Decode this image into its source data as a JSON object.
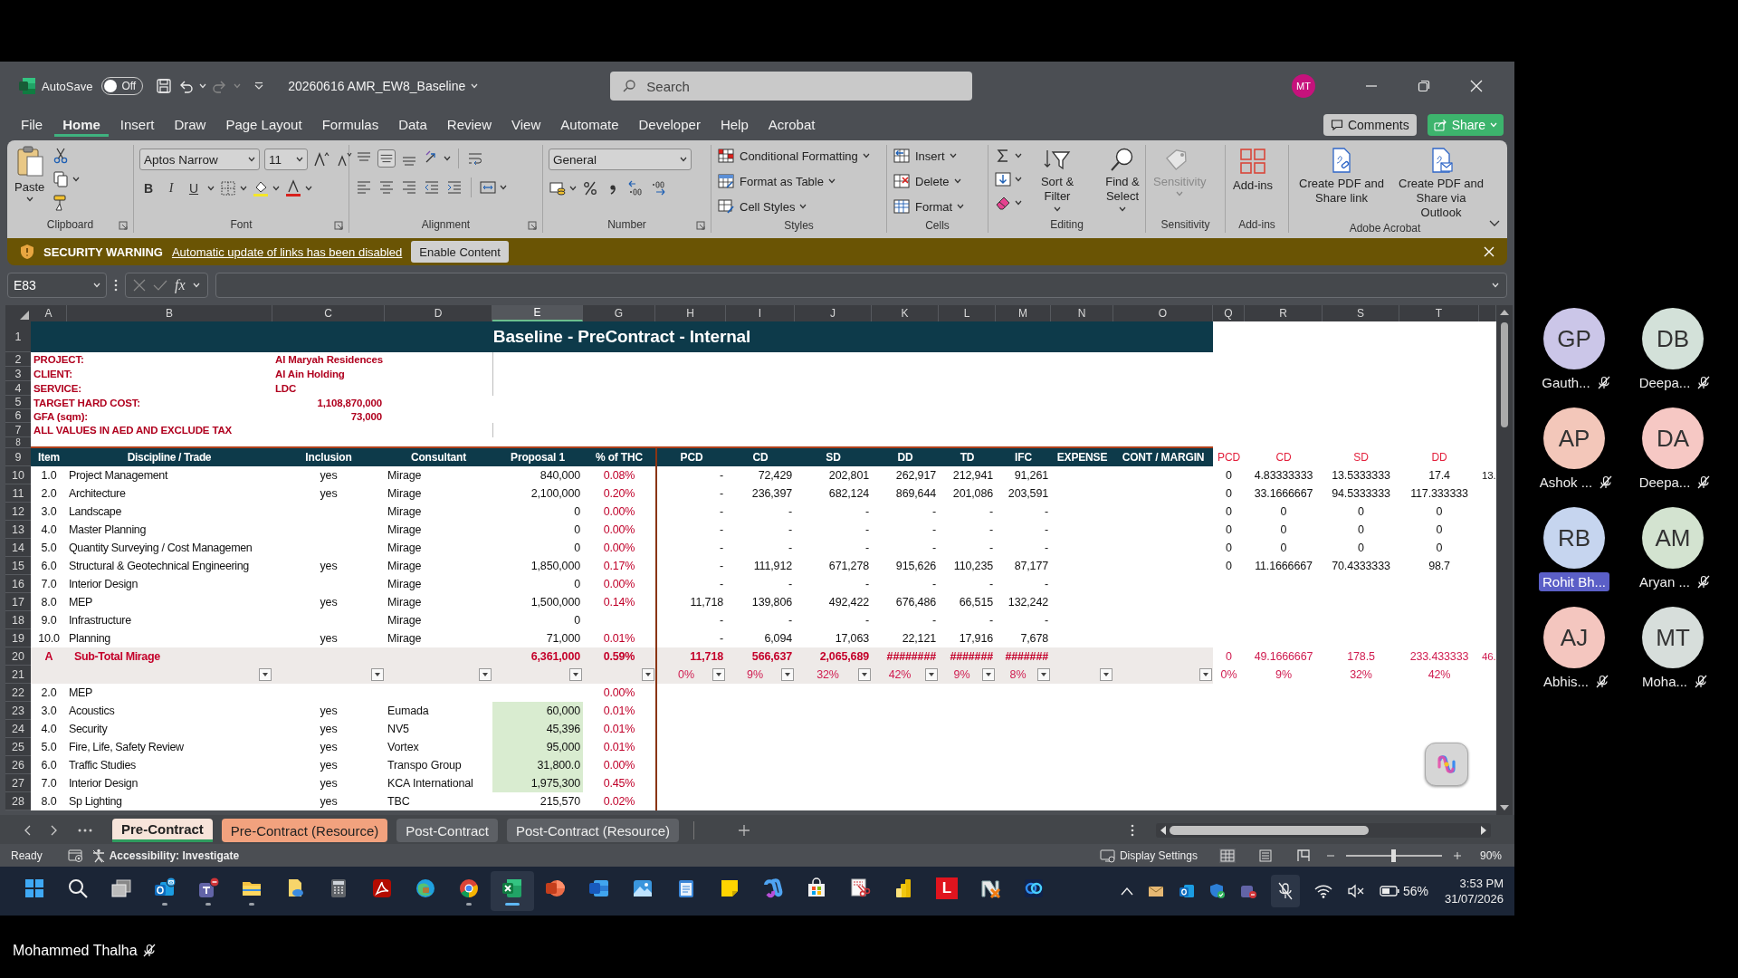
{
  "title_bar": {
    "autosave_label": "AutoSave",
    "autosave": {
      "label": "Off",
      "on": false
    },
    "file_name": "20260616 AMR_EW8_Baseline",
    "search": {
      "placeholder": "Search"
    },
    "avatar": "MT"
  },
  "menu": {
    "tabs": [
      {
        "label": "File",
        "selected": false
      },
      {
        "label": "Home",
        "selected": true
      },
      {
        "label": "Insert",
        "selected": false
      },
      {
        "label": "Draw",
        "selected": false
      },
      {
        "label": "Page Layout",
        "selected": false
      },
      {
        "label": "Formulas",
        "selected": false
      },
      {
        "label": "Data",
        "selected": false
      },
      {
        "label": "Review",
        "selected": false
      },
      {
        "label": "View",
        "selected": false
      },
      {
        "label": "Automate",
        "selected": false
      },
      {
        "label": "Developer",
        "selected": false
      },
      {
        "label": "Help",
        "selected": false
      },
      {
        "label": "Acrobat",
        "selected": false
      }
    ],
    "comments": "Comments",
    "share": "Share"
  },
  "ribbon": {
    "groups": [
      {
        "kind": "clipboard",
        "label": "Clipboard",
        "launcher": true,
        "buttons": [
          "Paste"
        ]
      },
      {
        "kind": "font",
        "label": "Font",
        "launcher": true,
        "font_name": "Aptos Narrow",
        "font_size": "11",
        "buttons": [
          "B",
          "I",
          "U"
        ]
      },
      {
        "kind": "alignment",
        "label": "Alignment",
        "launcher": true
      },
      {
        "kind": "number",
        "label": "Number",
        "launcher": true,
        "format": "General"
      },
      {
        "kind": "styles",
        "label": "Styles",
        "launcher": false,
        "buttons": [
          "Conditional Formatting",
          "Format as Table",
          "Cell Styles"
        ]
      },
      {
        "kind": "cells",
        "label": "Cells",
        "launcher": false,
        "buttons": [
          "Insert",
          "Delete",
          "Format"
        ]
      },
      {
        "kind": "editing",
        "label": "Editing",
        "launcher": false,
        "buttons": [
          "Sort & Filter",
          "Find & Select"
        ]
      },
      {
        "kind": "sensitivity",
        "label": "Sensitivity",
        "launcher": false,
        "disabled": true,
        "buttons": [
          "Sensitivity"
        ]
      },
      {
        "kind": "addins",
        "label": "Add-ins",
        "launcher": false,
        "buttons": [
          "Add-ins"
        ]
      },
      {
        "kind": "acrobat",
        "label": "Adobe Acrobat",
        "launcher": false,
        "buttons": [
          "Create PDF and Share link",
          "Create PDF and Share via Outlook"
        ]
      }
    ]
  },
  "security_bar": {
    "title": "SECURITY WARNING",
    "message": "Automatic update of links has been disabled",
    "button": "Enable Content"
  },
  "formula_bar": {
    "name_box": "E83",
    "function_label": "fx"
  },
  "sheet": {
    "columns": [
      {
        "letter": "A",
        "selected": false
      },
      {
        "letter": "B",
        "selected": false
      },
      {
        "letter": "C",
        "selected": false
      },
      {
        "letter": "D",
        "selected": false
      },
      {
        "letter": "E",
        "selected": true
      },
      {
        "letter": "G",
        "selected": false
      },
      {
        "letter": "H",
        "selected": false
      },
      {
        "letter": "I",
        "selected": false
      },
      {
        "letter": "J",
        "selected": false
      },
      {
        "letter": "K",
        "selected": false
      },
      {
        "letter": "L",
        "selected": false
      },
      {
        "letter": "M",
        "selected": false
      },
      {
        "letter": "N",
        "selected": false
      },
      {
        "letter": "O",
        "selected": false
      },
      {
        "letter": "Q",
        "selected": false
      },
      {
        "letter": "R",
        "selected": false
      },
      {
        "letter": "S",
        "selected": false
      },
      {
        "letter": "T",
        "selected": false
      },
      {
        "selected": false
      }
    ],
    "rows": [
      {
        "number": "1",
        "kind": "title",
        "title": "Baseline - PreContract - Internal"
      },
      {
        "number": "2",
        "kind": "info",
        "label": "PROJECT:",
        "value": "Al Maryah Residences"
      },
      {
        "number": "3",
        "kind": "info",
        "label": "CLIENT:",
        "value": "Al Ain Holding"
      },
      {
        "number": "4",
        "kind": "info",
        "label": "SERVICE:",
        "value": "LDC"
      },
      {
        "number": "5",
        "kind": "info_number",
        "label": "TARGET HARD COST:",
        "value": "1,108,870,000"
      },
      {
        "number": "6",
        "kind": "info_number",
        "label": "GFA (sqm):",
        "value": "73,000"
      },
      {
        "number": "7",
        "kind": "info",
        "label": "ALL VALUES IN AED AND EXCLUDE TAX"
      },
      {
        "number": "8",
        "kind": "spacer"
      },
      {
        "number": "9",
        "kind": "header",
        "cells": {
          "A": "Item",
          "B": "Discipline / Trade",
          "C": "Inclusion",
          "D": "Consultant",
          "E": "Proposal 1",
          "G": "% of THC",
          "H": "PCD",
          "I": "CD",
          "J": "SD",
          "K": "DD",
          "L": "TD",
          "M": "IFC",
          "N": "EXPENSE",
          "O": "CONT / MARGIN",
          "Q": "PCD",
          "R": "CD",
          "S": "SD",
          "T": "DD"
        }
      },
      {
        "number": "10",
        "kind": "item",
        "highlighted": false,
        "cells": {
          "A": "1.0",
          "B": "Project Management",
          "C": "yes",
          "D": "Mirage",
          "E": "840,000",
          "G": "0.08%",
          "H": "-",
          "I": "72,429",
          "J": "202,801",
          "K": "262,917",
          "L": "212,941",
          "M": "91,261",
          "Q": "0",
          "R": "4.83333333",
          "S": "13.5333333",
          "T": "17.4",
          "column_19": "13."
        }
      },
      {
        "number": "11",
        "kind": "item",
        "highlighted": false,
        "cells": {
          "A": "2.0",
          "B": "Architecture",
          "C": "yes",
          "D": "Mirage",
          "E": "2,100,000",
          "G": "0.20%",
          "H": "-",
          "I": "236,397",
          "J": "682,124",
          "K": "869,644",
          "L": "201,086",
          "M": "203,591",
          "Q": "0",
          "R": "33.1666667",
          "S": "94.5333333",
          "T": "117.333333"
        }
      },
      {
        "number": "12",
        "kind": "item",
        "highlighted": false,
        "cells": {
          "A": "3.0",
          "B": "Landscape",
          "D": "Mirage",
          "E": "0",
          "G": "0.00%",
          "H": "-",
          "I": "-",
          "J": "-",
          "K": "-",
          "L": "-",
          "M": "-",
          "Q": "0",
          "R": "0",
          "S": "0",
          "T": "0"
        }
      },
      {
        "number": "13",
        "kind": "item",
        "highlighted": false,
        "cells": {
          "A": "4.0",
          "B": "Master Planning",
          "D": "Mirage",
          "E": "0",
          "G": "0.00%",
          "H": "-",
          "I": "-",
          "J": "-",
          "K": "-",
          "L": "-",
          "M": "-",
          "Q": "0",
          "R": "0",
          "S": "0",
          "T": "0"
        }
      },
      {
        "number": "14",
        "kind": "item",
        "highlighted": false,
        "cells": {
          "A": "5.0",
          "B": "Quantity Surveying / Cost Managemen",
          "D": "Mirage",
          "E": "0",
          "G": "0.00%",
          "H": "-",
          "I": "-",
          "J": "-",
          "K": "-",
          "L": "-",
          "M": "-",
          "Q": "0",
          "R": "0",
          "S": "0",
          "T": "0"
        }
      },
      {
        "number": "15",
        "kind": "item",
        "highlighted": false,
        "cells": {
          "A": "6.0",
          "B": "Structural & Geotechnical Engineering",
          "C": "yes",
          "D": "Mirage",
          "E": "1,850,000",
          "G": "0.17%",
          "H": "-",
          "I": "111,912",
          "J": "671,278",
          "K": "915,626",
          "L": "110,235",
          "M": "87,177",
          "Q": "0",
          "R": "11.1666667",
          "S": "70.4333333",
          "T": "98.7"
        }
      },
      {
        "number": "16",
        "kind": "item",
        "highlighted": false,
        "cells": {
          "A": "7.0",
          "B": "Interior Design",
          "D": "Mirage",
          "E": "0",
          "G": "0.00%",
          "H": "-",
          "I": "-",
          "J": "-",
          "K": "-",
          "L": "-",
          "M": "-"
        }
      },
      {
        "number": "17",
        "kind": "item",
        "highlighted": false,
        "cells": {
          "A": "8.0",
          "B": "MEP",
          "C": "yes",
          "D": "Mirage",
          "E": "1,500,000",
          "G": "0.14%",
          "H": "11,718",
          "I": "139,806",
          "J": "492,422",
          "K": "676,486",
          "L": "66,515",
          "M": "132,242"
        }
      },
      {
        "number": "18",
        "kind": "item",
        "highlighted": false,
        "cells": {
          "A": "9.0",
          "B": "Infrastructure",
          "D": "Mirage",
          "E": "0",
          "H": "-",
          "I": "-",
          "J": "-",
          "K": "-",
          "L": "-",
          "M": "-"
        }
      },
      {
        "number": "19",
        "kind": "item",
        "highlighted": false,
        "cells": {
          "A": "10.0",
          "B": "Planning",
          "C": "yes",
          "D": "Mirage",
          "E": "71,000",
          "G": "0.01%",
          "H": "-",
          "I": "6,094",
          "J": "17,063",
          "K": "22,121",
          "L": "17,916",
          "M": "7,678"
        }
      },
      {
        "number": "20",
        "kind": "subtotal",
        "cells": {
          "A": "A",
          "B": "Sub-Total Mirage",
          "E": "6,361,000",
          "G": "0.59%",
          "H": "11,718",
          "I": "566,637",
          "J": "2,065,689",
          "K": "########",
          "L": "#######",
          "M": "#######",
          "Q": "0",
          "R": "49.1666667",
          "S": "178.5",
          "T": "233.433333",
          "column_19": "46."
        }
      },
      {
        "number": "21",
        "kind": "filter",
        "cells": {
          "B": {
            "filter": true
          },
          "C": {
            "filter": true
          },
          "D": {
            "filter": true
          },
          "E": {
            "filter": true
          },
          "G": {
            "filter": true
          },
          "H": {
            "value": "0%",
            "filter": true
          },
          "I": {
            "value": "9%",
            "filter": true
          },
          "J": {
            "value": "32%",
            "filter": true
          },
          "K": {
            "value": "42%",
            "filter": true
          },
          "L": {
            "value": "9%",
            "filter": true
          },
          "M": {
            "value": "8%",
            "filter": true
          },
          "N": {
            "filter": true
          },
          "O": {
            "filter": true
          },
          "Q": {
            "value": "0%",
            "filter": false
          },
          "R": {
            "value": "9%",
            "filter": false
          },
          "S": {
            "value": "32%",
            "filter": false
          },
          "T": {
            "value": "42%",
            "filter": false
          }
        }
      },
      {
        "number": "22",
        "kind": "item",
        "highlighted": false,
        "cells": {
          "A": "2.0",
          "B": "MEP",
          "G": "0.00%"
        }
      },
      {
        "number": "23",
        "kind": "item",
        "highlighted": true,
        "cells": {
          "A": "3.0",
          "B": "Acoustics",
          "C": "yes",
          "D": "Eumada",
          "E": "60,000",
          "G": "0.01%"
        }
      },
      {
        "number": "24",
        "kind": "item",
        "highlighted": true,
        "cells": {
          "A": "4.0",
          "B": "Security",
          "C": "yes",
          "D": "NV5",
          "E": "45,396",
          "G": "0.01%"
        }
      },
      {
        "number": "25",
        "kind": "item",
        "highlighted": true,
        "cells": {
          "A": "5.0",
          "B": "Fire, Life, Safety Review",
          "C": "yes",
          "D": "Vortex",
          "E": "95,000",
          "G": "0.01%"
        }
      },
      {
        "number": "26",
        "kind": "item",
        "highlighted": true,
        "cells": {
          "A": "6.0",
          "B": "Traffic Studies",
          "C": "yes",
          "D": "Transpo Group",
          "E": "31,800.0",
          "G": "0.00%"
        }
      },
      {
        "number": "27",
        "kind": "item",
        "highlighted": true,
        "cells": {
          "A": "7.0",
          "B": "Interior Design",
          "C": "yes",
          "D": "KCA International",
          "E": "1,975,300",
          "G": "0.45%"
        }
      },
      {
        "number": "28",
        "kind": "item",
        "highlighted": false,
        "cells": {
          "A": "8.0",
          "B": "Sp Lighting",
          "C": "yes",
          "D": "TBC",
          "E": "215,570",
          "G": "0.02%"
        }
      }
    ]
  },
  "sheet_tabs": [
    {
      "label": "Pre-Contract",
      "selected": true,
      "color": "#f7e4da"
    },
    {
      "label": "Pre-Contract (Resource)",
      "selected": false,
      "color": "#f2a27e"
    },
    {
      "label": "Post-Contract",
      "selected": false,
      "color": "#5d6065"
    },
    {
      "label": "Post-Contract (Resource)",
      "selected": false,
      "color": "#5d6065"
    }
  ],
  "status_bar": {
    "ready": "Ready",
    "accessibility": "Accessibility: Investigate",
    "display_settings": "Display Settings",
    "zoom": "90%",
    "zoom_slider": {
      "level": 0.49
    }
  },
  "taskbar": {
    "apps": [
      {
        "kind": "start",
        "running": false,
        "active": false
      },
      {
        "kind": "search",
        "running": false,
        "active": false
      },
      {
        "kind": "task_view",
        "running": false,
        "active": false
      },
      {
        "kind": "outlook",
        "running": true,
        "active": false
      },
      {
        "kind": "teams",
        "running": true,
        "active": false
      },
      {
        "kind": "explorer",
        "running": true,
        "active": false
      },
      {
        "kind": "files",
        "running": false,
        "active": false
      },
      {
        "kind": "calculator",
        "running": false,
        "active": false
      },
      {
        "kind": "acrobat",
        "running": false,
        "active": false
      },
      {
        "kind": "edge",
        "running": false,
        "active": false
      },
      {
        "kind": "chrome",
        "running": true,
        "active": false
      },
      {
        "kind": "excel",
        "running": true,
        "active": true
      },
      {
        "kind": "powerpoint",
        "running": false,
        "active": false
      },
      {
        "kind": "word",
        "running": false,
        "active": false
      },
      {
        "kind": "photos",
        "running": false,
        "active": false
      },
      {
        "kind": "notepad",
        "running": false,
        "active": false
      },
      {
        "kind": "sticky",
        "running": false,
        "active": false
      },
      {
        "kind": "m365",
        "running": false,
        "active": false
      },
      {
        "kind": "store",
        "running": false,
        "active": false
      },
      {
        "kind": "snip",
        "running": false,
        "active": false
      },
      {
        "kind": "powerbi",
        "running": false,
        "active": false
      },
      {
        "kind": "letter",
        "label": "L",
        "running": false,
        "active": false
      },
      {
        "kind": "nx",
        "running": false,
        "active": false
      },
      {
        "kind": "rings",
        "running": false,
        "active": false
      }
    ],
    "battery": "56%",
    "time": "3:53 PM",
    "date": "31/07/2026"
  },
  "participants": [
    {
      "initials": "GP",
      "name": "Gauth...",
      "color": "#cbc6e8",
      "muted": true,
      "highlighted": false
    },
    {
      "initials": "DB",
      "name": "Deepa...",
      "color": "#d3e1d9",
      "muted": true,
      "highlighted": false
    },
    {
      "initials": "AP",
      "name": "Ashok ...",
      "color": "#f3c7ba",
      "muted": true,
      "highlighted": false
    },
    {
      "initials": "DA",
      "name": "Deepa...",
      "color": "#f6c8c4",
      "muted": true,
      "highlighted": false
    },
    {
      "initials": "RB",
      "name": "Rohit Bh...",
      "color": "#c6d5ef",
      "muted": false,
      "highlighted": true
    },
    {
      "initials": "AM",
      "name": "Aryan ...",
      "color": "#d3e3d0",
      "muted": true,
      "highlighted": false
    },
    {
      "initials": "AJ",
      "name": "Abhis...",
      "color": "#f4c6bf",
      "muted": true,
      "highlighted": false
    },
    {
      "initials": "MT",
      "name": "Moha...",
      "color": "#d7dedb",
      "muted": true,
      "highlighted": false
    }
  ],
  "presenter": {
    "name": "Mohammed Thalha",
    "muted": true
  }
}
